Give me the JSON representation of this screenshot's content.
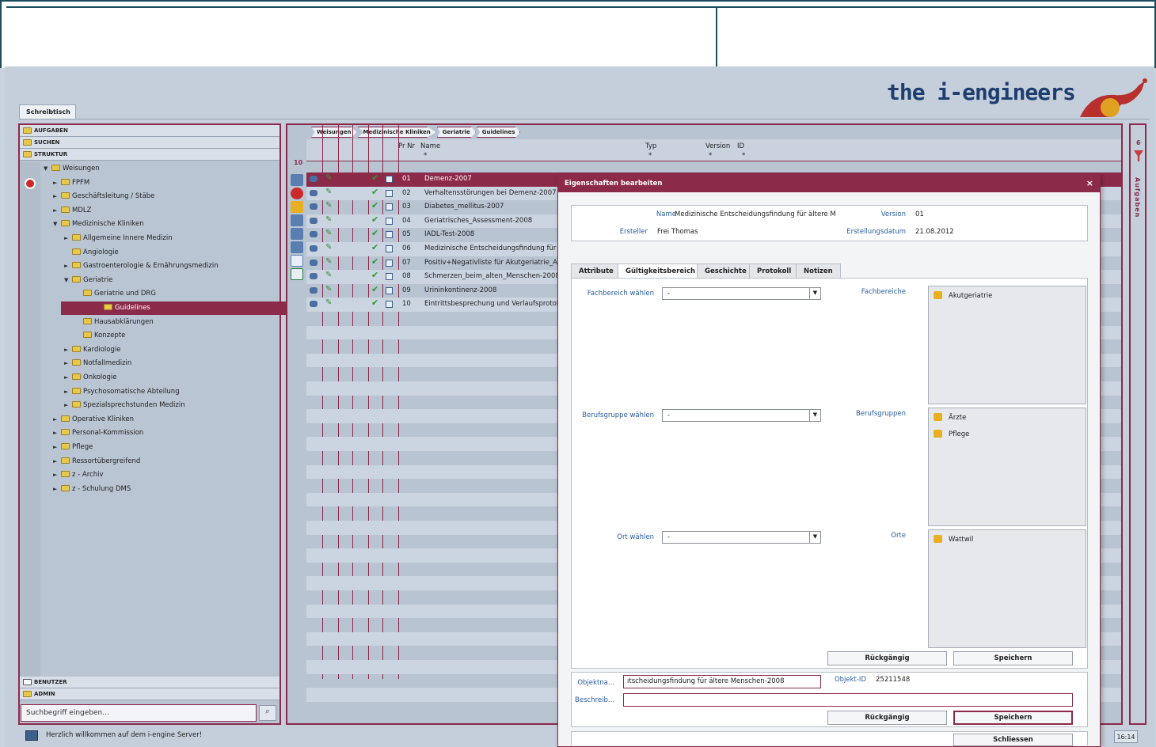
{
  "app": {
    "logo": "the i-engineers",
    "desk_tab": "Schreibtisch",
    "status_message": "Herzlich willkommen auf dem i-engine Server!",
    "clock": "16:14"
  },
  "left": {
    "accordion_top": [
      "AUFGABEN",
      "SUCHEN",
      "STRUKTUR"
    ],
    "accordion_bottom": [
      "BENUTZER",
      "ADMIN"
    ],
    "tree": [
      {
        "label": "Weisungen",
        "arrow": "▼"
      },
      {
        "label": "FPFM",
        "arrow": "►"
      },
      {
        "label": "Geschäftsleitung / Stäbe",
        "arrow": "►"
      },
      {
        "label": "MDLZ",
        "arrow": "►"
      },
      {
        "label": "Medizinische Kliniken",
        "arrow": "▼"
      },
      {
        "label": "Allgemeine Innere Medizin",
        "arrow": "►"
      },
      {
        "label": "Angiologie",
        "arrow": ""
      },
      {
        "label": "Gastroenterologie & Ernährungsmedizin",
        "arrow": "►"
      },
      {
        "label": "Geriatrie",
        "arrow": "▼"
      },
      {
        "label": "Geriatrie und DRG",
        "arrow": ""
      },
      {
        "label": "Guidelines",
        "arrow": ""
      },
      {
        "label": "Hausabklärungen",
        "arrow": ""
      },
      {
        "label": "Konzepte",
        "arrow": ""
      },
      {
        "label": "Kardiologie",
        "arrow": "►"
      },
      {
        "label": "Notfallmedizin",
        "arrow": "►"
      },
      {
        "label": "Onkologie",
        "arrow": "►"
      },
      {
        "label": "Psychosomatische Abteilung",
        "arrow": "►"
      },
      {
        "label": "Spezialsprechstunden Medizin",
        "arrow": "►"
      },
      {
        "label": "Operative Kliniken",
        "arrow": "►"
      },
      {
        "label": "Personal-Kommission",
        "arrow": "►"
      },
      {
        "label": "Pflege",
        "arrow": "►"
      },
      {
        "label": "Ressortübergreifend",
        "arrow": "►"
      },
      {
        "label": "z - Archiv",
        "arrow": "►"
      },
      {
        "label": "z - Schulung DMS",
        "arrow": "►"
      }
    ],
    "search_placeholder": "Suchbegriff eingeben..."
  },
  "center": {
    "breadcrumbs": [
      "Weisungen",
      "Medizinische Kliniken",
      "Geriatrie",
      "Guidelines"
    ],
    "count": "10",
    "columns": {
      "nr": "Pr Nr",
      "name": "Name",
      "typ": "Typ",
      "version": "Version",
      "id": "ID"
    },
    "filter_star": "*",
    "rows": [
      {
        "nr": "01",
        "name": "Demenz-2007"
      },
      {
        "nr": "02",
        "name": "Verhaltensstörungen bei Demenz-2007"
      },
      {
        "nr": "03",
        "name": "Diabetes_mellitus-2007"
      },
      {
        "nr": "04",
        "name": "Geriatrisches_Assessment-2008"
      },
      {
        "nr": "05",
        "name": "IADL-Test-2008"
      },
      {
        "nr": "06",
        "name": "Medizinische Entscheidungsfindung für ält"
      },
      {
        "nr": "07",
        "name": "Positiv+Negativliste für Akutgeriatrie_April"
      },
      {
        "nr": "08",
        "name": "Schmerzen_beim_alten_Menschen-2008"
      },
      {
        "nr": "09",
        "name": "Urininkontinenz-2008"
      },
      {
        "nr": "10",
        "name": "Eintrittsbesprechung und Verlaufsprotoko"
      }
    ]
  },
  "right": {
    "count": "6",
    "label": "Aufgaben"
  },
  "dialog": {
    "title": "Eigenschaften bearbeiten",
    "close": "×",
    "name_label": "Name",
    "name_value": "Medizinische Entscheidungsfindung für ältere M",
    "version_label": "Version",
    "version_value": "01",
    "creator_label": "Ersteller",
    "creator_value": "Frei Thomas",
    "date_label": "Erstellungsdatum",
    "date_value": "21.08.2012",
    "tabs": [
      "Attribute",
      "Gültigkeitsbereich",
      "Geschichte",
      "Protokoll",
      "Notizen"
    ],
    "fach_select_label": "Fachbereich wählen",
    "fach_list_label": "Fachbereiche",
    "fach_items": [
      "Akutgeriatrie"
    ],
    "beruf_select_label": "Berufsgruppe wählen",
    "beruf_list_label": "Berufsgruppen",
    "beruf_items": [
      "Ärzte",
      "Pflege"
    ],
    "ort_select_label": "Ort wählen",
    "ort_list_label": "Orte",
    "ort_items": [
      "Wattwil"
    ],
    "select_value": "-",
    "undo": "Rückgängig",
    "save": "Speichern",
    "obj_name_label": "Objektna...",
    "obj_name_value": "ıtscheidungsfindung für ältere Menschen-2008",
    "obj_id_label": "Objekt-ID",
    "obj_id_value": "25211548",
    "desc_label": "Beschreib...",
    "desc_value": "",
    "close_btn": "Schliessen"
  },
  "colors": {
    "accent": "#8c2a4a",
    "brand": "#1d3e6e",
    "label_blue": "#2a5ca0"
  }
}
